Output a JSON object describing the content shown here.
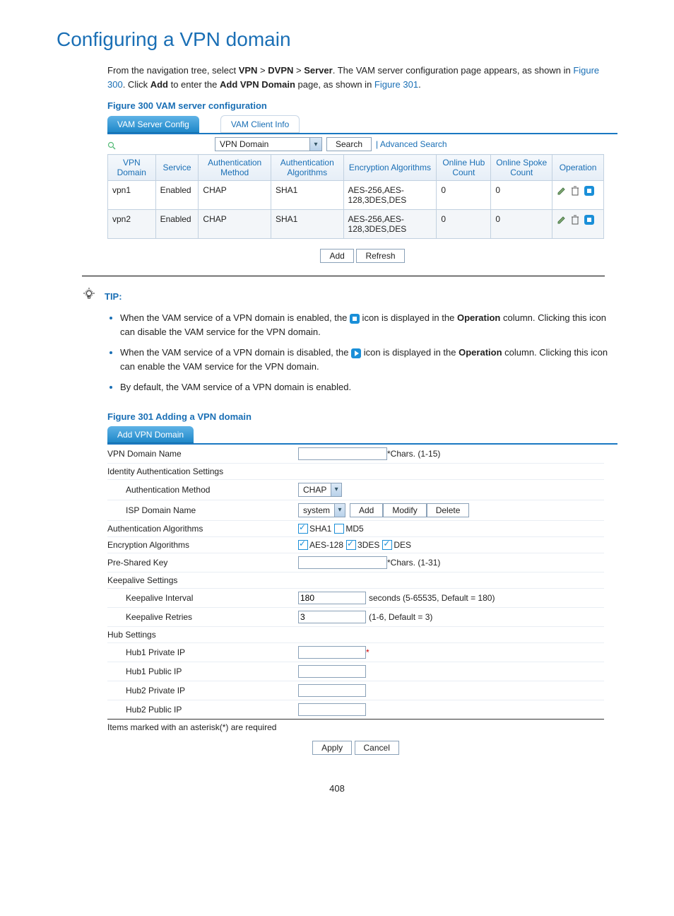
{
  "title": "Configuring a VPN domain",
  "intro_a": "From the navigation tree, select ",
  "intro_vpn": "VPN",
  "intro_sep": " > ",
  "intro_dvpn": "DVPN",
  "intro_server": "Server",
  "intro_b": ". The VAM server configuration page appears, as shown in ",
  "intro_fig300": "Figure 300",
  "intro_c": ". Click ",
  "intro_add": "Add",
  "intro_d": " to enter the ",
  "intro_addvpn": "Add VPN Domain",
  "intro_e": " page, as shown in ",
  "intro_fig301": "Figure 301",
  "intro_f": ".",
  "figure300_caption": "Figure 300 VAM server configuration",
  "tabs": {
    "active": "VAM Server Config",
    "inactive": "VAM Client Info"
  },
  "search": {
    "field_label": "VPN Domain",
    "search_btn": "Search",
    "advanced": "Advanced Search"
  },
  "table_headers": [
    "VPN Domain",
    "Service",
    "Authentication Method",
    "Authentication Algorithms",
    "Encryption Algorithms",
    "Online Hub Count",
    "Online Spoke Count",
    "Operation"
  ],
  "rows": [
    {
      "c": [
        "vpn1",
        "Enabled",
        "CHAP",
        "SHA1",
        "AES-256,AES-128,3DES,DES",
        "0",
        "0"
      ]
    },
    {
      "c": [
        "vpn2",
        "Enabled",
        "CHAP",
        "SHA1",
        "AES-256,AES-128,3DES,DES",
        "0",
        "0"
      ]
    }
  ],
  "btn_add": "Add",
  "btn_refresh": "Refresh",
  "tip_label": "TIP:",
  "tip1_a": "When the VAM service of a VPN domain is enabled, the ",
  "tip1_b": " icon is displayed in the ",
  "tip_op": "Operation",
  "tip1_c": " column. Clicking this icon can disable the VAM service for the VPN domain.",
  "tip2_a": "When the VAM service of a VPN domain is disabled, the ",
  "tip2_b": " icon is displayed in the ",
  "tip2_c": " column. Clicking this icon can enable the VAM service for the VPN domain.",
  "tip3": "By default, the VAM service of a VPN domain is enabled.",
  "figure301_caption": "Figure 301 Adding a VPN domain",
  "f301_tab": "Add VPN Domain",
  "form": {
    "vpn_domain_name": "VPN Domain Name",
    "vpn_domain_hint": "*Chars. (1-15)",
    "identity": "Identity Authentication Settings",
    "auth_method": "Authentication Method",
    "auth_method_val": "CHAP",
    "isp": "ISP Domain Name",
    "isp_val": "system",
    "isp_add": "Add",
    "isp_modify": "Modify",
    "isp_delete": "Delete",
    "auth_algos": "Authentication Algorithms",
    "sha1": "SHA1",
    "md5": "MD5",
    "enc_algos": "Encryption Algorithms",
    "aes128": "AES-128",
    "tdes": "3DES",
    "des": "DES",
    "psk": "Pre-Shared Key",
    "psk_hint": "*Chars. (1-31)",
    "keepalive": "Keepalive Settings",
    "ki": "Keepalive Interval",
    "ki_val": "180",
    "ki_hint": "seconds (5-65535, Default = 180)",
    "kr": "Keepalive Retries",
    "kr_val": "3",
    "kr_hint": "(1-6, Default = 3)",
    "hub": "Hub Settings",
    "h1p": "Hub1 Private IP",
    "h1u": "Hub1 Public IP",
    "h2p": "Hub2 Private IP",
    "h2u": "Hub2 Public IP",
    "req_note": "Items marked with an asterisk(*) are required",
    "apply": "Apply",
    "cancel": "Cancel"
  },
  "page_number": "408"
}
